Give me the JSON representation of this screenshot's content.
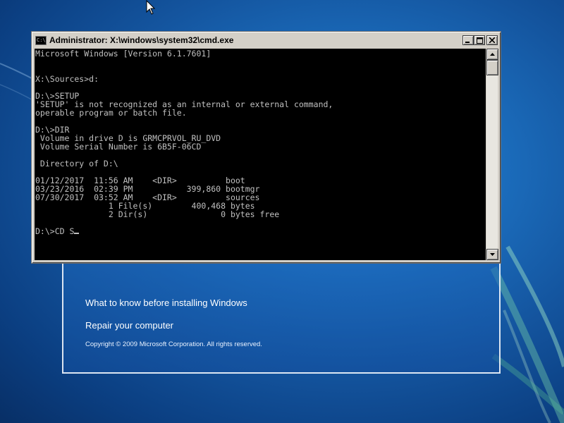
{
  "console_window": {
    "title": "Administrator: X:\\windows\\system32\\cmd.exe",
    "icon_label": "C:\\",
    "lines": [
      "Microsoft Windows [Version 6.1.7601]",
      "",
      "",
      "X:\\Sources>d:",
      "",
      "D:\\>SETUP",
      "'SETUP' is not recognized as an internal or external command,",
      "operable program or batch file.",
      "",
      "D:\\>DIR",
      " Volume in drive D is GRMCPRVOL_RU_DVD",
      " Volume Serial Number is 6B5F-06CD",
      "",
      " Directory of D:\\",
      "",
      "01/12/2017  11:56 AM    <DIR>          boot",
      "03/23/2016  02:39 PM           399,860 bootmgr",
      "07/30/2017  03:52 AM    <DIR>          sources",
      "               1 File(s)        400,468 bytes",
      "               2 Dir(s)               0 bytes free",
      "",
      "D:\\>CD S"
    ],
    "colors": {
      "background": "#000000",
      "text": "#c0c0c0",
      "chrome": "#d4d0c8"
    }
  },
  "setup_window": {
    "link_know_before": "What to know before installing Windows",
    "link_repair": "Repair your computer",
    "copyright": "Copyright © 2009 Microsoft Corporation. All rights reserved."
  },
  "icons": {
    "minimize": "minimize-icon",
    "maximize": "maximize-icon",
    "close": "close-icon",
    "scroll_up": "arrow-up-icon",
    "scroll_down": "arrow-down-icon",
    "cursor": "mouse-pointer-icon"
  }
}
